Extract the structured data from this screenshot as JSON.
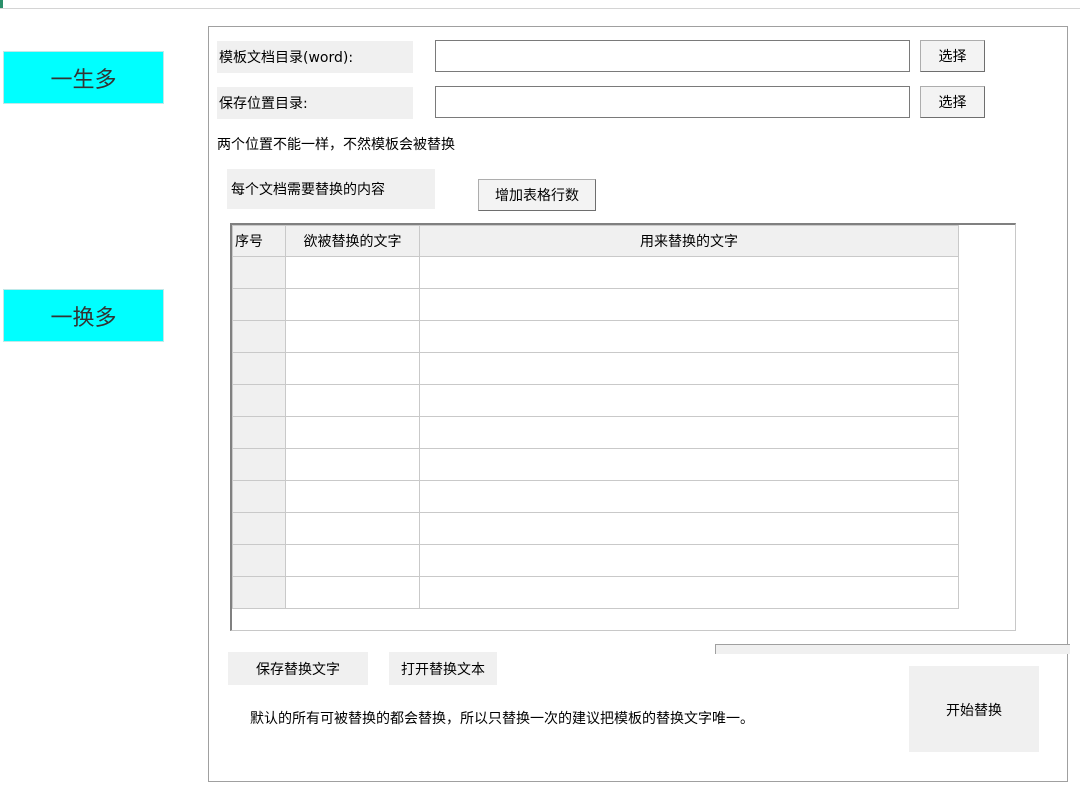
{
  "sidebar": {
    "one_to_many": "一生多",
    "replace_many": "一换多"
  },
  "form": {
    "template_dir_label": "模板文档目录(word):",
    "template_dir_value": "",
    "save_dir_label": "保存位置目录:",
    "save_dir_value": "",
    "browse_label": "选择",
    "warning": "两个位置不能一样，不然模板会被替换"
  },
  "grid_section": {
    "heading": "每个文档需要替换的内容",
    "add_rows_label": "增加表格行数",
    "columns": [
      "序号",
      "欲被替换的文字",
      "用来替换的文字"
    ],
    "rows": [
      [
        "",
        "",
        ""
      ],
      [
        "",
        "",
        ""
      ],
      [
        "",
        "",
        ""
      ],
      [
        "",
        "",
        ""
      ],
      [
        "",
        "",
        ""
      ],
      [
        "",
        "",
        ""
      ],
      [
        "",
        "",
        ""
      ],
      [
        "",
        "",
        ""
      ],
      [
        "",
        "",
        ""
      ],
      [
        "",
        "",
        ""
      ],
      [
        "",
        "",
        ""
      ]
    ]
  },
  "footer": {
    "save_text_label": "保存替换文字",
    "open_text_label": "打开替换文本",
    "note": "默认的所有可被替换的都会替换，所以只替换一次的建议把模板的替换文字唯一。",
    "start_label": "开始替换"
  },
  "colors": {
    "side_button": "#00ffff",
    "panel_bg": "#f0f0f0"
  }
}
